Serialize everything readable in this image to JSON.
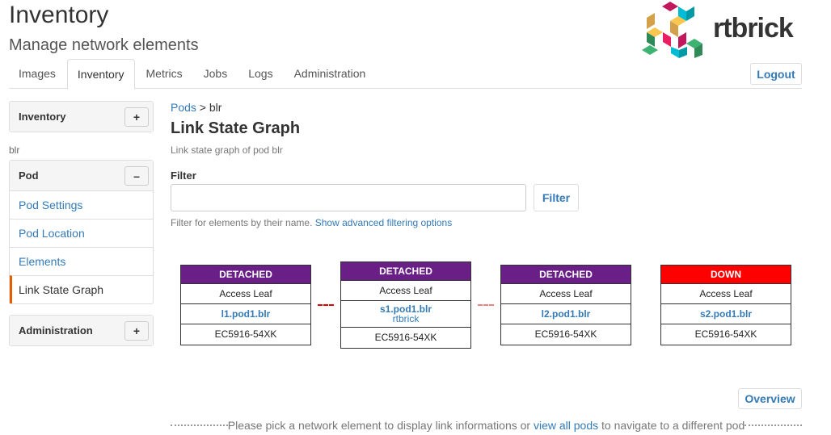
{
  "header": {
    "title": "Inventory",
    "subtitle": "Manage network elements",
    "logo_text": "rtbrick",
    "logout": "Logout"
  },
  "tabs": [
    {
      "label": "Images"
    },
    {
      "label": "Inventory",
      "active": true
    },
    {
      "label": "Metrics"
    },
    {
      "label": "Jobs"
    },
    {
      "label": "Logs"
    },
    {
      "label": "Administration"
    }
  ],
  "sidebar": {
    "inventory": "Inventory",
    "plus": "+",
    "minus": "–",
    "context": "blr",
    "pod": "Pod",
    "items": [
      {
        "label": "Pod Settings"
      },
      {
        "label": "Pod Location"
      },
      {
        "label": "Elements"
      },
      {
        "label": "Link State Graph",
        "active": true
      }
    ],
    "administration": "Administration"
  },
  "main": {
    "breadcrumb_link": "Pods",
    "breadcrumb_sep": " > ",
    "breadcrumb_current": "blr",
    "title": "Link State Graph",
    "description": "Link state graph of pod blr",
    "filter_label": "Filter",
    "filter_value": "",
    "filter_button": "Filter",
    "filter_help": "Filter for elements by their name.",
    "filter_advanced": "Show advanced filtering options",
    "overview": "Overview",
    "footer_pre": "Please pick a network element to display link informations or ",
    "footer_link": "view all pods",
    "footer_post": " to navigate to a different pod"
  },
  "colors": {
    "detached": "#6a1f87",
    "down": "#ff0000",
    "link_down": "#e00000",
    "link_faint": "#f08080"
  },
  "nodes": [
    {
      "status": "DETACHED",
      "role": "Access Leaf",
      "name": "l1.pod1.blr",
      "model": "EC5916-54XK"
    },
    {
      "status": "DETACHED",
      "role": "Access Leaf",
      "name": "s1.pod1.blr",
      "vendor": "rtbrick",
      "model": "EC5916-54XK"
    },
    {
      "status": "DETACHED",
      "role": "Access Leaf",
      "name": "l2.pod1.blr",
      "model": "EC5916-54XK"
    },
    {
      "status": "DOWN",
      "role": "Access Leaf",
      "name": "s2.pod1.blr",
      "model": "EC5916-54XK"
    }
  ]
}
